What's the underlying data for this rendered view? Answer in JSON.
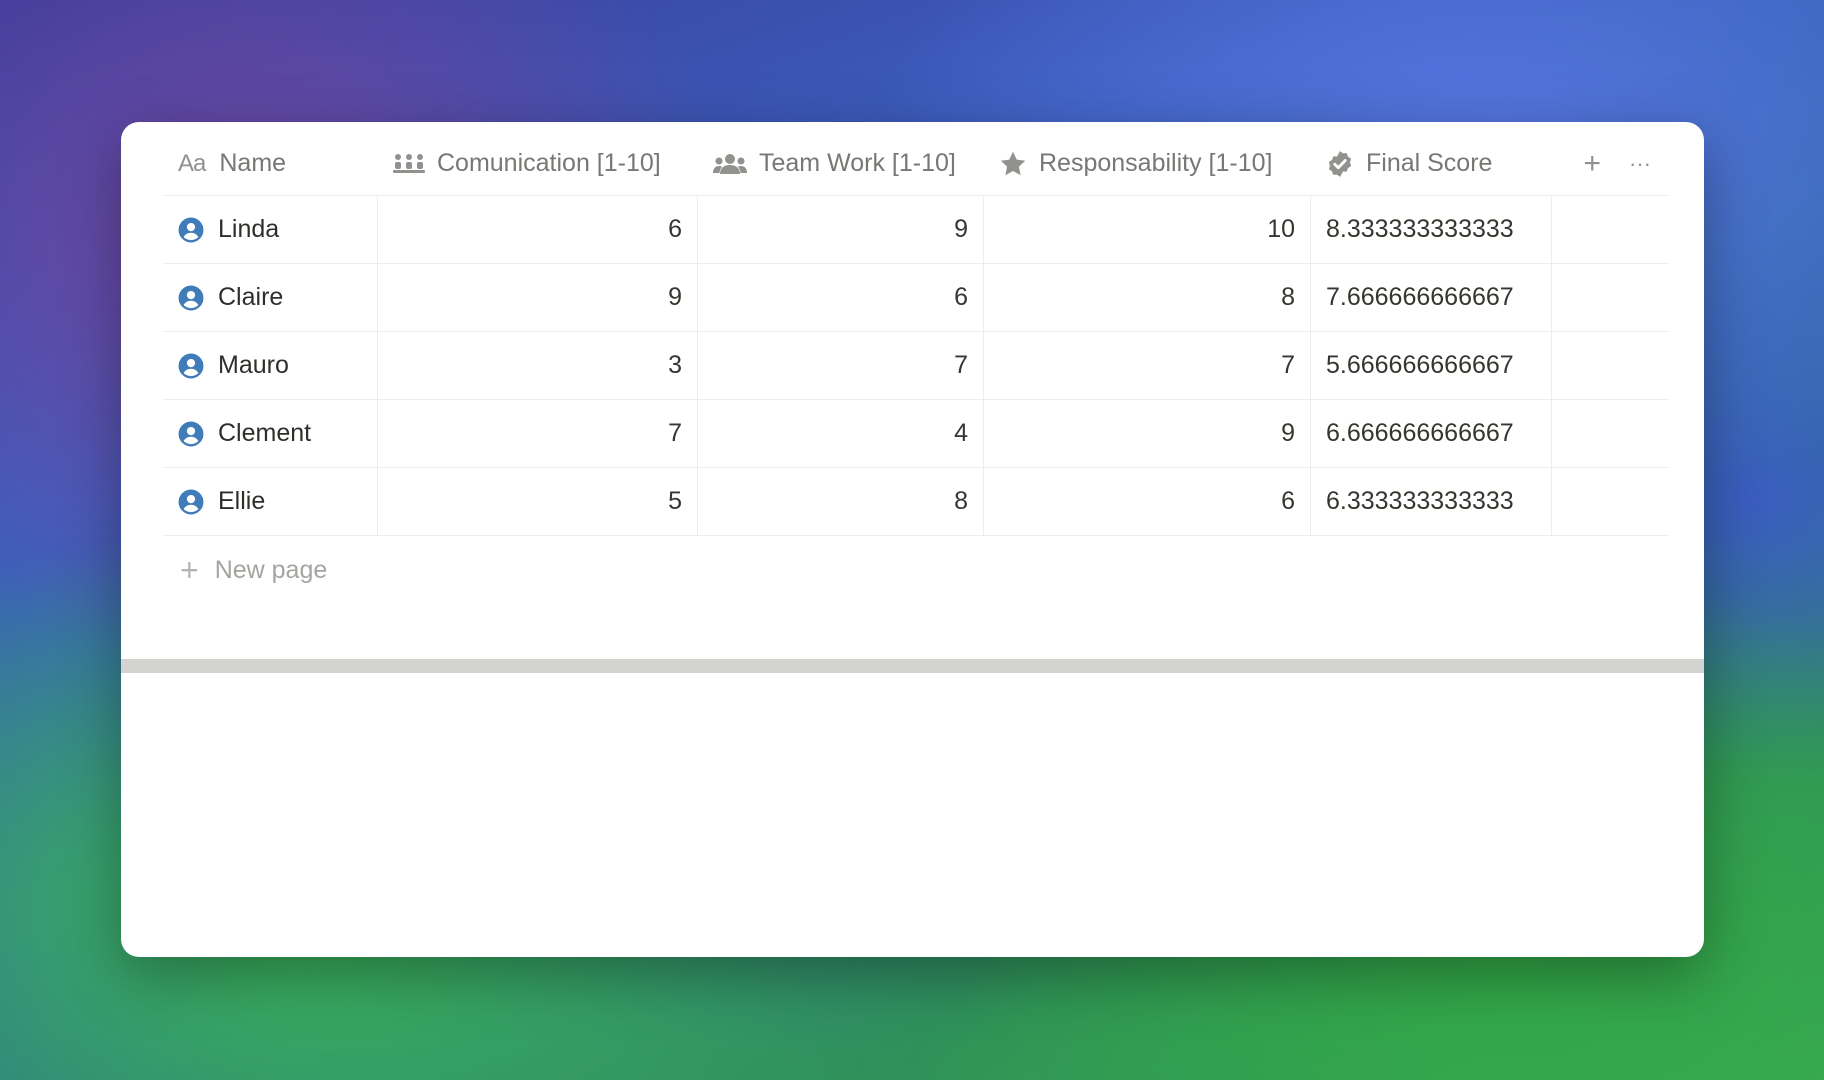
{
  "table": {
    "columns": [
      {
        "label": "Name",
        "icon": "text-aa-icon"
      },
      {
        "label": "Comunication [1-10]",
        "icon": "group-meeting-icon"
      },
      {
        "label": "Team Work [1-10]",
        "icon": "people-icon"
      },
      {
        "label": "Responsability [1-10]",
        "icon": "star-icon"
      },
      {
        "label": "Final Score",
        "icon": "verified-badge-icon"
      }
    ],
    "add_column_label": "+",
    "more_label": "···",
    "rows": [
      {
        "name": "Linda",
        "comunication": "6",
        "team_work": "9",
        "responsability": "10",
        "final_score": "8.333333333333"
      },
      {
        "name": "Claire",
        "comunication": "9",
        "team_work": "6",
        "responsability": "8",
        "final_score": "7.666666666667"
      },
      {
        "name": "Mauro",
        "comunication": "3",
        "team_work": "7",
        "responsability": "7",
        "final_score": "5.666666666667"
      },
      {
        "name": "Clement",
        "comunication": "7",
        "team_work": "4",
        "responsability": "9",
        "final_score": "6.666666666667"
      },
      {
        "name": "Ellie",
        "comunication": "5",
        "team_work": "8",
        "responsability": "6",
        "final_score": "6.333333333333"
      }
    ],
    "new_page_label": "New page",
    "icon_color": "#91918e",
    "person_icon_color": "#3f7cb8"
  }
}
